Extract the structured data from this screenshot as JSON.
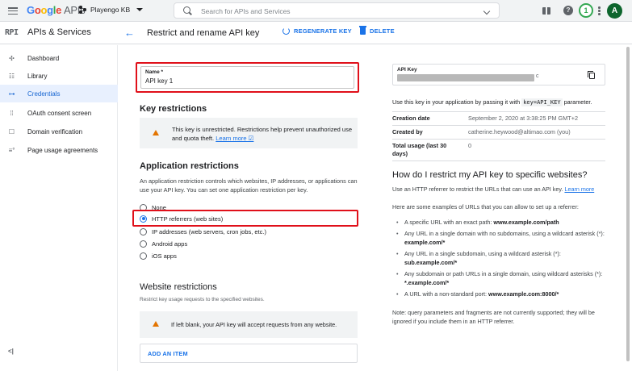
{
  "topbar": {
    "logo_google": [
      "G",
      "o",
      "o",
      "g",
      "l",
      "e"
    ],
    "logo_apis": "APIs",
    "project_name": "Playengo KB",
    "search_placeholder": "Search for APIs and Services",
    "help_glyph": "?",
    "notification_count": "1",
    "avatar_initial": "A",
    "icons": [
      "menu-icon",
      "search-icon",
      "chevron-down-icon",
      "gift-icon",
      "help-icon",
      "kebab-icon"
    ]
  },
  "header": {
    "api_badge": "RPI",
    "product_title": "APIs & Services",
    "back_arrow": "←",
    "page_title": "Restrict and rename API key",
    "regenerate_label": "REGENERATE KEY",
    "delete_label": "DELETE"
  },
  "sidebar": {
    "items": [
      {
        "label": "Dashboard",
        "icon": "✣",
        "active": false
      },
      {
        "label": "Library",
        "icon": "☷",
        "active": false
      },
      {
        "label": "Credentials",
        "icon": "⊶",
        "active": true
      },
      {
        "label": "OAuth consent screen",
        "icon": "⁞⁞",
        "active": false
      },
      {
        "label": "Domain verification",
        "icon": "☐",
        "active": false
      },
      {
        "label": "Page usage agreements",
        "icon": "≡°",
        "active": false
      }
    ],
    "collapse_glyph": "<|"
  },
  "name_field": {
    "label": "Name *",
    "value": "API key 1"
  },
  "key_restrictions": {
    "heading": "Key restrictions",
    "warning_text": "This key is unrestricted. Restrictions help prevent unauthorized use and quota theft.",
    "learn_more": "Learn more ☑"
  },
  "application_restrictions": {
    "heading": "Application restrictions",
    "description": "An application restriction controls which websites, IP addresses, or applications can use your API key. You can set one application restriction per key.",
    "options": [
      {
        "label": "None",
        "selected": false
      },
      {
        "label": "HTTP referrers (web sites)",
        "selected": true
      },
      {
        "label": "IP addresses (web servers, cron jobs, etc.)",
        "selected": false
      },
      {
        "label": "Android apps",
        "selected": false
      },
      {
        "label": "iOS apps",
        "selected": false
      }
    ]
  },
  "website_restrictions": {
    "heading": "Website restrictions",
    "description": "Restrict key usage requests to the specified websites.",
    "warning_text": "If left blank, your API key will accept requests from any website.",
    "add_item_label": "ADD AN ITEM"
  },
  "api_key_panel": {
    "label": "API Key",
    "masked_tail": "c",
    "use_prefix": "Use this key in your application by passing it with",
    "use_code": "key=API_KEY",
    "use_suffix": "parameter.",
    "rows": [
      {
        "k": "Creation date",
        "v": "September 2, 2020 at 3:38:25 PM GMT+2"
      },
      {
        "k": "Created by",
        "v": "catherine.heywood@altimao.com (you)"
      },
      {
        "k": "Total usage (last 30 days)",
        "v": "0"
      }
    ]
  },
  "howto": {
    "heading": "How do I restrict my API key to specific websites?",
    "desc": "Use an HTTP referrer to restrict the URLs that can use an API key.",
    "learn_more": "Learn more",
    "examples_intro": "Here are some examples of URLs that you can allow to set up a referrer:",
    "examples": [
      {
        "text": "A specific URL with an exact path: ",
        "bold": "www.example.com/path"
      },
      {
        "text": "Any URL in a single domain with no subdomains, using a wildcard asterisk (*): ",
        "bold": "example.com/*"
      },
      {
        "text": "Any URL in a single subdomain, using a wildcard asterisk (*): ",
        "bold": "sub.example.com/*"
      },
      {
        "text": "Any subdomain or path URLs in a single domain, using wildcard asterisks (*): ",
        "bold": "*.example.com/*"
      },
      {
        "text": "A URL with a non-standard port: ",
        "bold": "www.example.com:8000/*"
      }
    ],
    "note": "Note: query parameters and fragments are not currently supported; they will be ignored if you include them in an HTTP referrer."
  },
  "colors": {
    "accent": "#1a73e8",
    "highlight_red": "#e0101a",
    "warning_orange": "#e37400",
    "active_nav_bg": "#e8f0fe"
  }
}
